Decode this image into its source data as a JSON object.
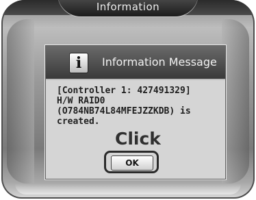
{
  "window": {
    "title": "Information"
  },
  "dialog": {
    "header": "Information Message",
    "icon": "info-icon",
    "message_lines": [
      "[Controller 1: 427491329]",
      "H/W RAID0",
      "(O784NB74L84MFEJZZKDB) is",
      "created."
    ],
    "annotation": "Click",
    "ok_label": "OK"
  }
}
